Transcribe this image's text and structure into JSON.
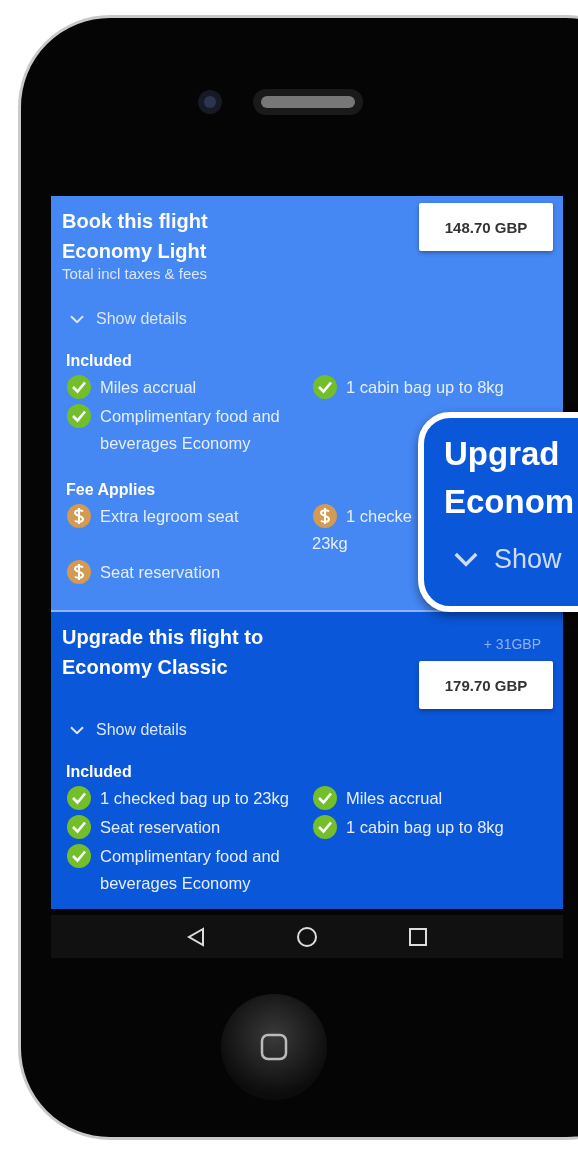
{
  "screen": {
    "fares": [
      {
        "kind": "book",
        "title": "Book this flight Economy Light",
        "subtitle": "Total incl taxes & fees",
        "price": "148.70 GBP",
        "details_toggle": "Show details",
        "sections": [
          {
            "heading": "Included",
            "items": [
              {
                "kind": "included",
                "text": "Miles accrual"
              },
              {
                "kind": "included",
                "text": "1 cabin bag up to 8kg"
              },
              {
                "kind": "included",
                "text": "Complimentary food and beverages Economy"
              }
            ]
          },
          {
            "heading": "Fee Applies",
            "items": [
              {
                "kind": "fee",
                "text": "Extra legroom seat"
              },
              {
                "kind": "fee",
                "text": "1 checke",
                "text_2": "23kg"
              },
              {
                "kind": "fee",
                "text": "Seat reservation"
              }
            ]
          }
        ]
      },
      {
        "kind": "upgrade",
        "title": "Upgrade this flight to Economy Classic",
        "price_difference": "+ 31GBP",
        "price": "179.70 GBP",
        "details_toggle": "Show details",
        "sections": [
          {
            "heading": "Included",
            "items": [
              {
                "kind": "included",
                "text": "1 checked bag up to 23kg"
              },
              {
                "kind": "included",
                "text": "Miles accrual"
              },
              {
                "kind": "included",
                "text": "Seat reservation"
              },
              {
                "kind": "included",
                "text": "1 cabin bag up to 8kg"
              },
              {
                "kind": "included",
                "text": "Complimentary food and beverages Economy"
              }
            ]
          }
        ]
      }
    ]
  },
  "callout": {
    "title_lines": [
      "Upgrad",
      "Econom"
    ],
    "toggle": "Show"
  }
}
